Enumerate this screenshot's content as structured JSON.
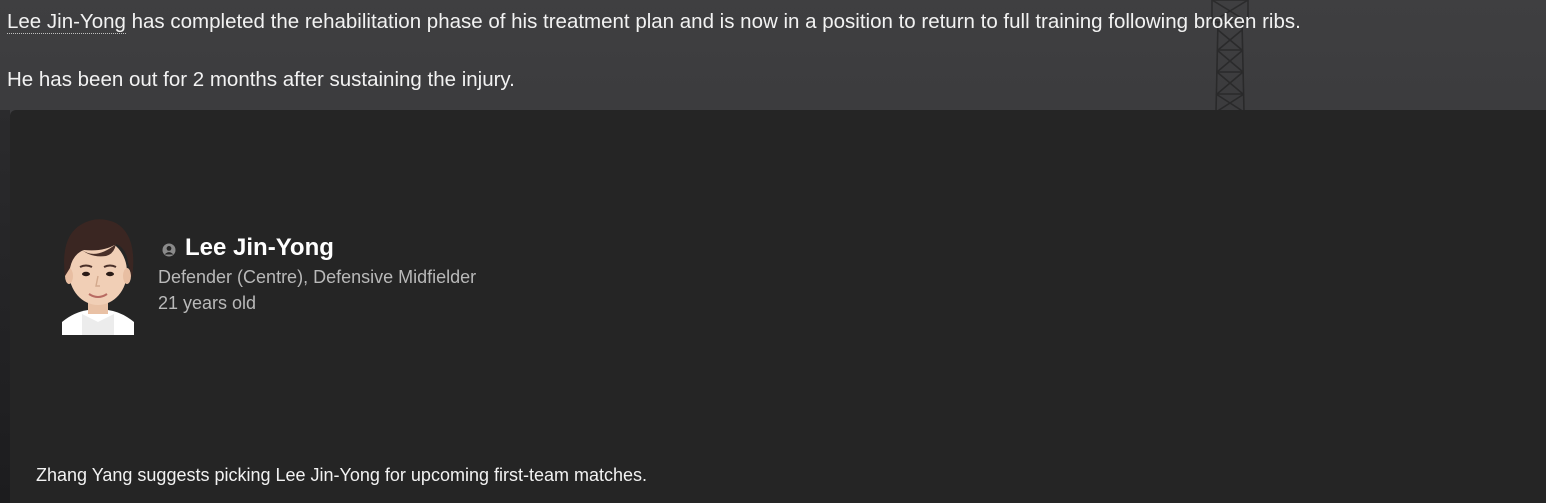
{
  "news": {
    "player_link": "Lee Jin-Yong",
    "sentence_rest": " has completed the rehabilitation phase of his treatment plan and is now in a position to return to full training following broken ribs.",
    "second_line": "He has been out for 2 months after sustaining the injury."
  },
  "player_card": {
    "status_icon": "person-icon",
    "name": "Lee Jin-Yong",
    "positions": "Defender (Centre), Defensive Midfielder",
    "age": "21 years old"
  },
  "suggestion": "Zhang Yang suggests picking Lee Jin-Yong for upcoming first-team matches."
}
